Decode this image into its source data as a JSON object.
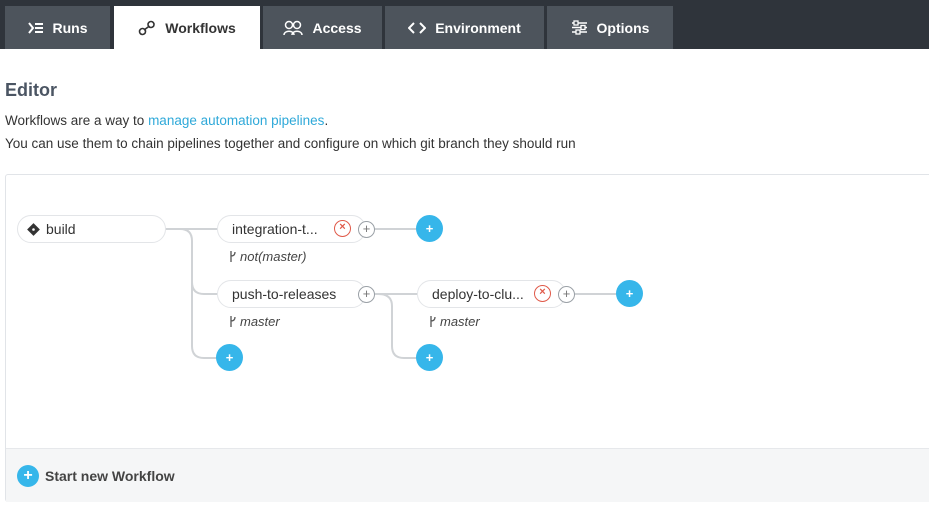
{
  "tabs": [
    {
      "label": "Runs",
      "icon": "runs-icon",
      "active": false
    },
    {
      "label": "Workflows",
      "icon": "workflows-icon",
      "active": true
    },
    {
      "label": "Access",
      "icon": "access-icon",
      "active": false
    },
    {
      "label": "Environment",
      "icon": "code-icon",
      "active": false
    },
    {
      "label": "Options",
      "icon": "sliders-icon",
      "active": false
    }
  ],
  "editor": {
    "title": "Editor",
    "desc_prefix": "Workflows are a way to ",
    "desc_link": "manage automation pipelines",
    "desc_suffix": ".",
    "desc_line2": "You can use them to chain pipelines together and configure on which git branch they should run"
  },
  "workflow": {
    "root": {
      "label": "build"
    },
    "nodes": [
      {
        "label": "integration-t...",
        "branch": "not(master)"
      },
      {
        "label": "push-to-releases",
        "branch": "master"
      },
      {
        "label": "deploy-to-clu...",
        "branch": "master"
      }
    ],
    "add_symbol": "+",
    "remove_symbol": "×"
  },
  "footer": {
    "start_label": "Start new Workflow"
  },
  "colors": {
    "topbar": "#2f343b",
    "tab": "#4d545c",
    "accent": "#36b6ea",
    "link": "#2fa9d9",
    "danger": "#e05a4a"
  }
}
